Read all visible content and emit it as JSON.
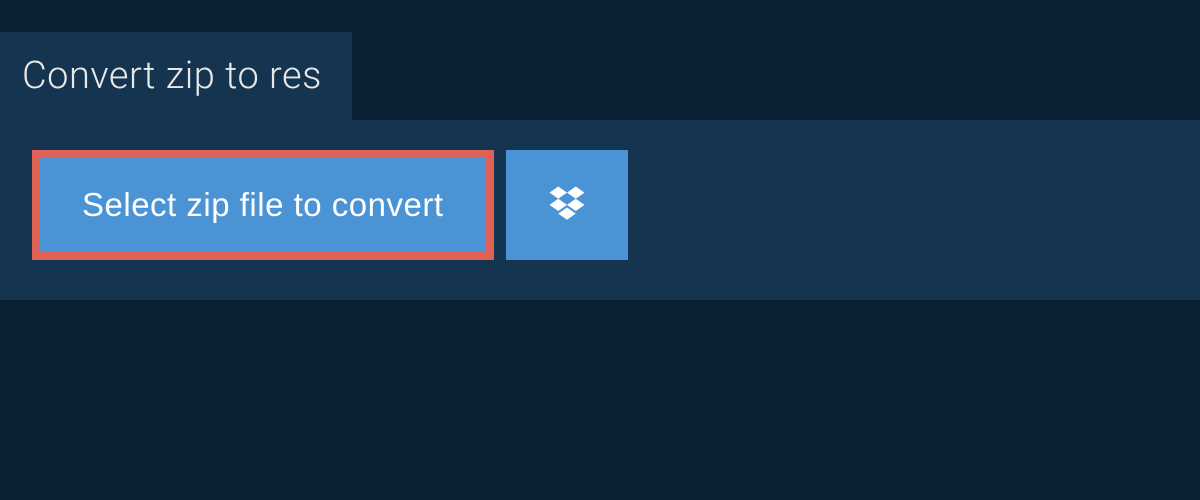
{
  "header": {
    "title": "Convert zip to res"
  },
  "actions": {
    "select_label": "Select zip file to convert",
    "dropbox_aria": "Select from Dropbox"
  },
  "colors": {
    "bg_dark": "#0c2033",
    "panel": "#14344f",
    "button": "#4a94d6",
    "highlight_border": "#e06257",
    "text_light": "#e8e8e8",
    "button_text": "#ffffff"
  }
}
